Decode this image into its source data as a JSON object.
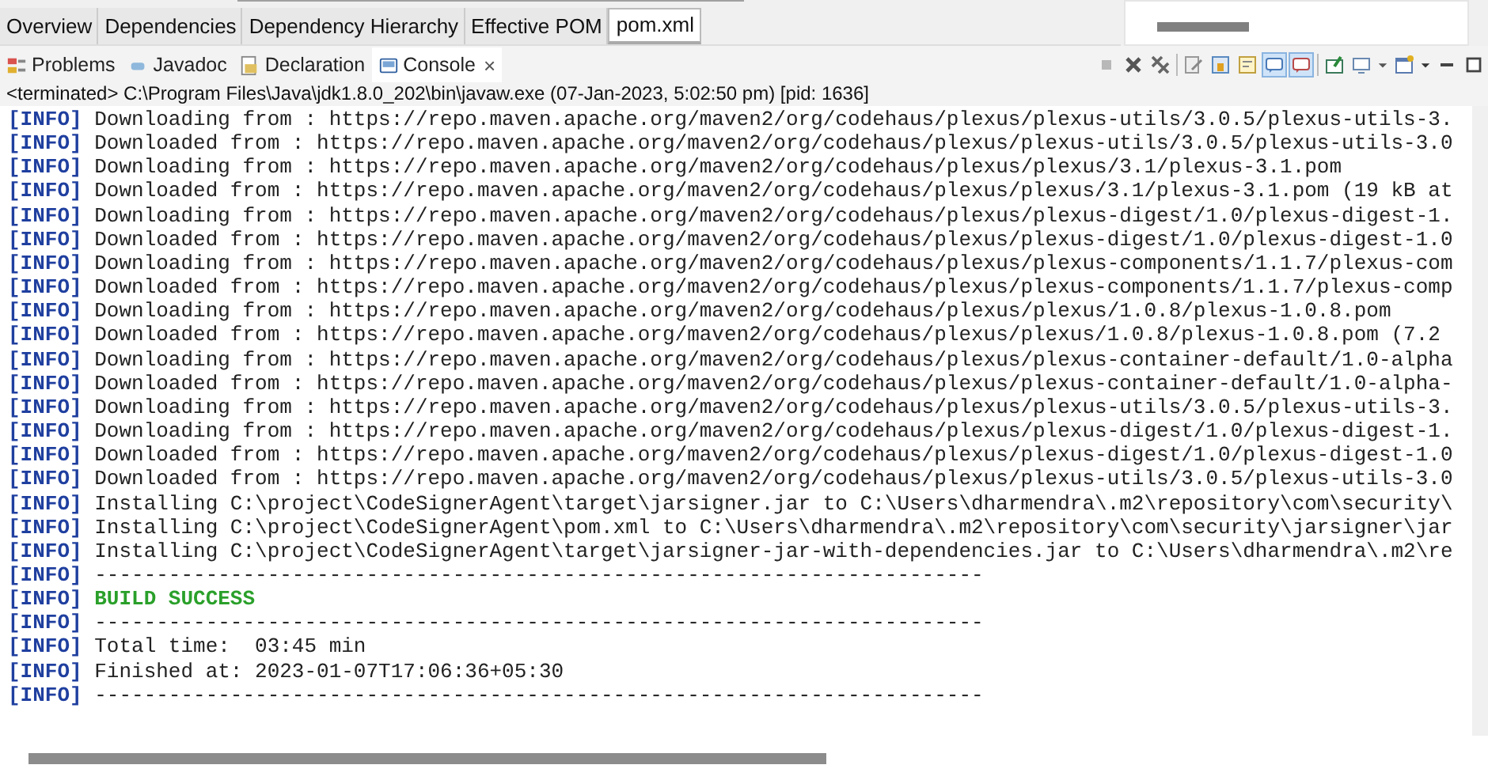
{
  "editor_tabs": [
    {
      "label": "Overview",
      "selected": false
    },
    {
      "label": "Dependencies",
      "selected": false
    },
    {
      "label": "Dependency Hierarchy",
      "selected": false
    },
    {
      "label": "Effective POM",
      "selected": false
    },
    {
      "label": "pom.xml",
      "selected": true
    }
  ],
  "view_tabs": [
    {
      "label": "Problems",
      "kind": "problems",
      "selected": false
    },
    {
      "label": "Javadoc",
      "kind": "javadoc",
      "selected": false
    },
    {
      "label": "Declaration",
      "kind": "declaration",
      "selected": false
    },
    {
      "label": "Console",
      "kind": "console",
      "selected": true,
      "close": "×"
    }
  ],
  "console": {
    "status": "<terminated> C:\\Program Files\\Java\\jdk1.8.0_202\\bin\\javaw.exe (07-Jan-2023, 5:02:50 pm) [pid: 1636]",
    "lines": [
      {
        "tag": "[INFO]",
        "kind": "log",
        "text": "Downloading from : https://repo.maven.apache.org/maven2/org/codehaus/plexus/plexus-utils/3.0.5/plexus-utils-3."
      },
      {
        "tag": "[INFO]",
        "kind": "log",
        "text": "Downloaded from : https://repo.maven.apache.org/maven2/org/codehaus/plexus/plexus-utils/3.0.5/plexus-utils-3.0"
      },
      {
        "tag": "[INFO]",
        "kind": "log",
        "text": "Downloading from : https://repo.maven.apache.org/maven2/org/codehaus/plexus/plexus/3.1/plexus-3.1.pom"
      },
      {
        "tag": "[INFO]",
        "kind": "log",
        "text": "Downloaded from : https://repo.maven.apache.org/maven2/org/codehaus/plexus/plexus/3.1/plexus-3.1.pom (19 kB at"
      },
      {
        "tag": "[INFO]",
        "kind": "log",
        "text": "Downloading from : https://repo.maven.apache.org/maven2/org/codehaus/plexus/plexus-digest/1.0/plexus-digest-1."
      },
      {
        "tag": "[INFO]",
        "kind": "log",
        "text": "Downloaded from : https://repo.maven.apache.org/maven2/org/codehaus/plexus/plexus-digest/1.0/plexus-digest-1.0"
      },
      {
        "tag": "[INFO]",
        "kind": "log",
        "text": "Downloading from : https://repo.maven.apache.org/maven2/org/codehaus/plexus/plexus-components/1.1.7/plexus-com"
      },
      {
        "tag": "[INFO]",
        "kind": "log",
        "text": "Downloaded from : https://repo.maven.apache.org/maven2/org/codehaus/plexus/plexus-components/1.1.7/plexus-comp"
      },
      {
        "tag": "[INFO]",
        "kind": "log",
        "text": "Downloading from : https://repo.maven.apache.org/maven2/org/codehaus/plexus/plexus/1.0.8/plexus-1.0.8.pom"
      },
      {
        "tag": "[INFO]",
        "kind": "log",
        "text": "Downloaded from : https://repo.maven.apache.org/maven2/org/codehaus/plexus/plexus/1.0.8/plexus-1.0.8.pom (7.2"
      },
      {
        "tag": "[INFO]",
        "kind": "log",
        "text": "Downloading from : https://repo.maven.apache.org/maven2/org/codehaus/plexus/plexus-container-default/1.0-alpha"
      },
      {
        "tag": "[INFO]",
        "kind": "log",
        "text": "Downloaded from : https://repo.maven.apache.org/maven2/org/codehaus/plexus/plexus-container-default/1.0-alpha-"
      },
      {
        "tag": "[INFO]",
        "kind": "log",
        "text": "Downloading from : https://repo.maven.apache.org/maven2/org/codehaus/plexus/plexus-utils/3.0.5/plexus-utils-3."
      },
      {
        "tag": "[INFO]",
        "kind": "log",
        "text": "Downloading from : https://repo.maven.apache.org/maven2/org/codehaus/plexus/plexus-digest/1.0/plexus-digest-1."
      },
      {
        "tag": "[INFO]",
        "kind": "log",
        "text": "Downloaded from : https://repo.maven.apache.org/maven2/org/codehaus/plexus/plexus-digest/1.0/plexus-digest-1.0"
      },
      {
        "tag": "[INFO]",
        "kind": "log",
        "text": "Downloaded from : https://repo.maven.apache.org/maven2/org/codehaus/plexus/plexus-utils/3.0.5/plexus-utils-3.0"
      },
      {
        "tag": "[INFO]",
        "kind": "log",
        "text": "Installing C:\\project\\CodeSignerAgent\\target\\jarsigner.jar to C:\\Users\\dharmendra\\.m2\\repository\\com\\security\\"
      },
      {
        "tag": "[INFO]",
        "kind": "log",
        "text": "Installing C:\\project\\CodeSignerAgent\\pom.xml to C:\\Users\\dharmendra\\.m2\\repository\\com\\security\\jarsigner\\jar"
      },
      {
        "tag": "[INFO]",
        "kind": "log",
        "text": "Installing C:\\project\\CodeSignerAgent\\target\\jarsigner-jar-with-dependencies.jar to C:\\Users\\dharmendra\\.m2\\re"
      },
      {
        "tag": "[INFO]",
        "kind": "log",
        "text": "------------------------------------------------------------------------"
      },
      {
        "tag": "[INFO]",
        "kind": "success",
        "text": "BUILD SUCCESS"
      },
      {
        "tag": "[INFO]",
        "kind": "log",
        "text": "------------------------------------------------------------------------"
      },
      {
        "tag": "[INFO]",
        "kind": "log",
        "text": "Total time:  03:45 min"
      },
      {
        "tag": "[INFO]",
        "kind": "log",
        "text": "Finished at: 2023-01-07T17:06:36+05:30"
      },
      {
        "tag": "[INFO]",
        "kind": "log",
        "text": "------------------------------------------------------------------------"
      }
    ]
  }
}
